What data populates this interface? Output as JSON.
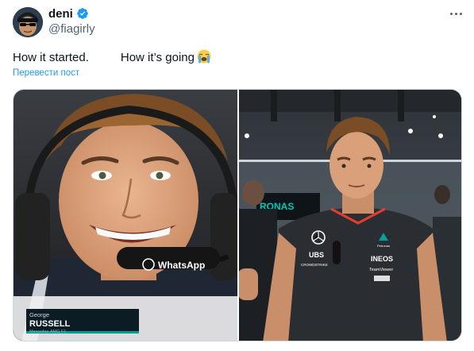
{
  "tweet": {
    "display_name": "deni",
    "handle": "@fiagirly",
    "verified": true,
    "text_part1": "How it started.",
    "text_part2": "How it’s going",
    "text_emoji": "loudly-crying-face-emoji",
    "translate_label": "Перевести пост"
  },
  "media": {
    "left_photo": {
      "headset_brand": "WhatsApp",
      "lower_third_first": "George",
      "lower_third_last": "RUSSELL",
      "lower_third_team": "Mercedes-AMG F1"
    },
    "right_photo": {
      "shirt_sponsors": [
        "UBS",
        "INEOS",
        "TeamViewer",
        "CROWDSTRIKE",
        "Petronas"
      ],
      "background_sign": "RONAS"
    }
  },
  "icons": {
    "verified": "verified-badge-icon",
    "more": "more-options-icon"
  },
  "colors": {
    "link": "#1d9bf0",
    "secondary_text": "#536471",
    "verified": "#1d9bf0"
  }
}
